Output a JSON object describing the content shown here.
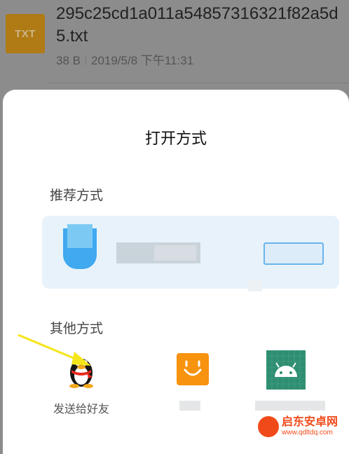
{
  "file": {
    "icon_text": "TXT",
    "name": "295c25cd1a011a54857316321f82a5d5.txt",
    "size": "38 B",
    "date": "2019/5/8 下午11:31"
  },
  "sheet": {
    "title": "打开方式",
    "recommended_label": "推荐方式",
    "others_label": "其他方式",
    "apps": [
      {
        "label": "发送给好友",
        "icon": "qq-penguin-icon"
      },
      {
        "label": "",
        "icon": "orange-smile-app-icon"
      },
      {
        "label": "",
        "icon": "android-app-icon"
      }
    ]
  },
  "watermark": {
    "title": "启东安卓网",
    "url": "www.qdltdq.com"
  },
  "colors": {
    "file_icon": "#b07a14",
    "recommend_card": "#e7f2fb",
    "arrow": "#f5e51a",
    "watermark": "#f04a1a"
  }
}
